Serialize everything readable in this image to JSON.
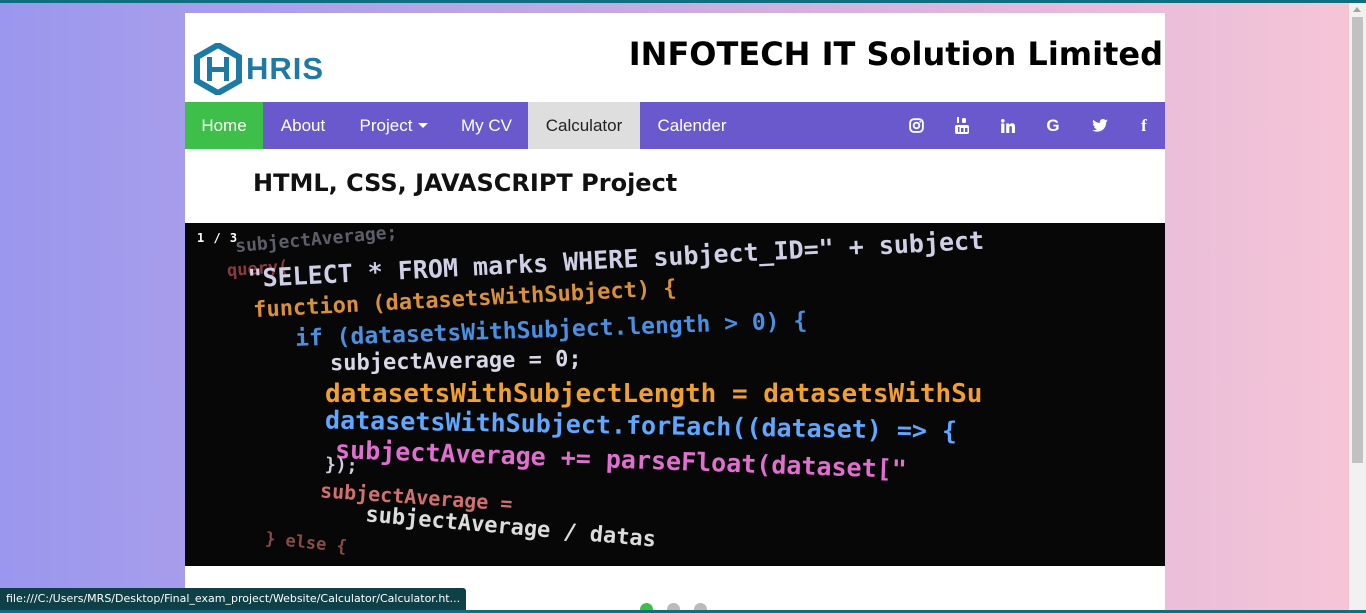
{
  "header": {
    "logo_text": "HRIS",
    "site_title": "INFOTECH IT Solution Limited"
  },
  "nav": {
    "items": [
      {
        "label": "Home",
        "state": "active"
      },
      {
        "label": "About"
      },
      {
        "label": "Project",
        "has_dropdown": true
      },
      {
        "label": "My CV"
      },
      {
        "label": "Calculator",
        "state": "current"
      },
      {
        "label": "Calender"
      }
    ],
    "social": [
      "instagram-icon",
      "youtube-icon",
      "linkedin-icon",
      "google-icon",
      "twitter-icon",
      "facebook-icon"
    ],
    "google_glyph": "G",
    "facebook_glyph": "f"
  },
  "main": {
    "section_title": "HTML, CSS, JAVASCRIPT Project",
    "slideshow": {
      "counter": "1 / 3",
      "code_lines": [
        "    subjectAverage;",
        "query(",
        "  \"SELECT * FROM marks WHERE subject_ID=\" + subject",
        "function (datasetsWithSubject) {",
        "  if (datasetsWithSubject.length > 0) {",
        "    subjectAverage = 0;",
        "    datasetsWithSubjectLength = datasetsWithSu",
        "    datasetsWithSubject.forEach((dataset) => {",
        "      subjectAverage += parseFloat(dataset[\"",
        "    });",
        "    subjectAverage =",
        "      subjectAverage / datas",
        "  } else {"
      ],
      "dot_count": 3,
      "active_dot": 0
    }
  },
  "colors": {
    "nav_bg": "#6a59cd",
    "nav_active": "#3ebf4a",
    "nav_current": "#dedede",
    "logo": "#1d7aa4"
  },
  "status_bar": {
    "url": "file:///C:/Users/MRS/Desktop/Final_exam_project/Website/Calculator/Calculator.ht..."
  }
}
